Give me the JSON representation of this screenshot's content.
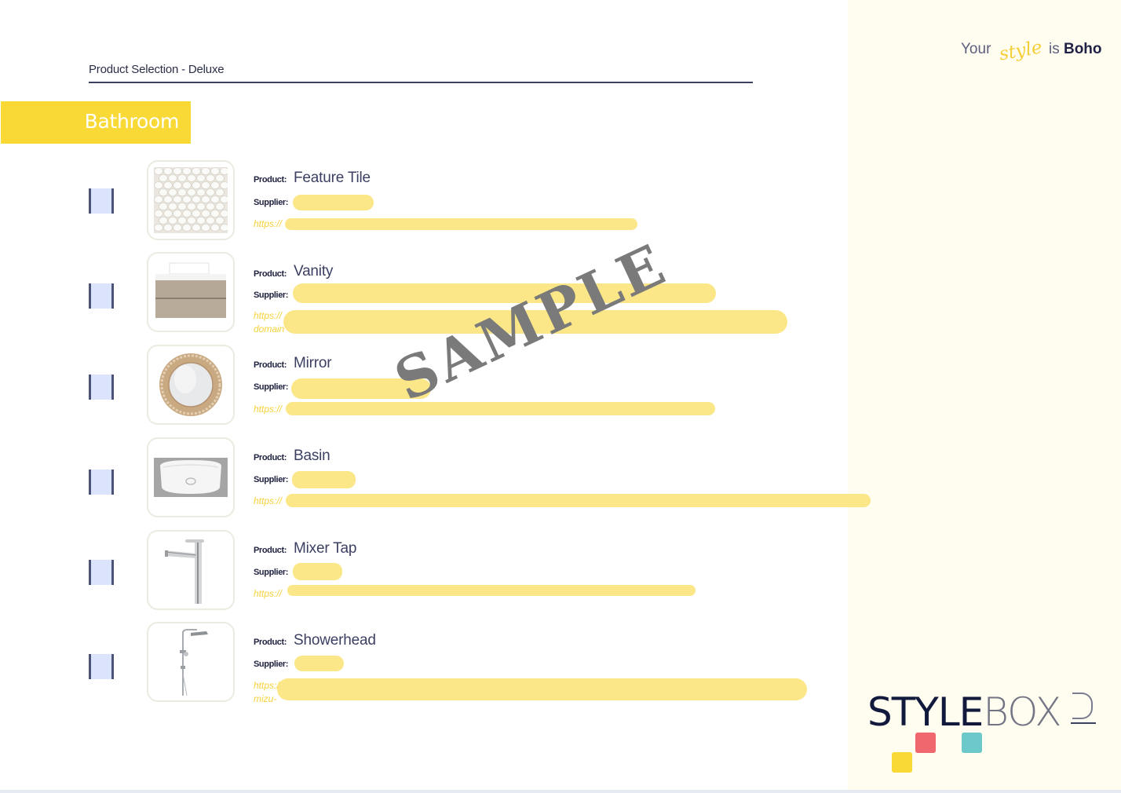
{
  "header": {
    "title": "Product Selection - Deluxe"
  },
  "category": {
    "label": "Bathroom"
  },
  "tagline": {
    "prefix": "Your",
    "script_word": "style",
    "middle": "is",
    "style_name": "Boho"
  },
  "labels": {
    "product": "Product:",
    "supplier": "Supplier:",
    "url_prefix": "https://",
    "url_domain_prefix": "domain",
    "url_mizu_prefix": "mizu-"
  },
  "products": [
    {
      "name": "Feature Tile",
      "image": "hexagon-tile-image",
      "checked": false
    },
    {
      "name": "Vanity",
      "image": "vanity-cabinet-image",
      "checked": false
    },
    {
      "name": "Mirror",
      "image": "round-rattan-mirror-image",
      "checked": false
    },
    {
      "name": "Basin",
      "image": "vessel-basin-image",
      "checked": false
    },
    {
      "name": "Mixer Tap",
      "image": "tall-mixer-tap-image",
      "checked": false
    },
    {
      "name": "Showerhead",
      "image": "shower-rail-image",
      "checked": false
    }
  ],
  "watermark": {
    "text": "SAMPLE"
  },
  "brand": {
    "part1": "STYLE",
    "part2": "BOX",
    "colors": {
      "red": "#f0676d",
      "teal": "#6cc8cb",
      "yellow": "#f8d936"
    }
  },
  "colors": {
    "accent_yellow": "#f8d936",
    "redaction": "#fbe787",
    "panel_bg": "#fffcf0",
    "checkbox_fill": "#dce3fd"
  }
}
